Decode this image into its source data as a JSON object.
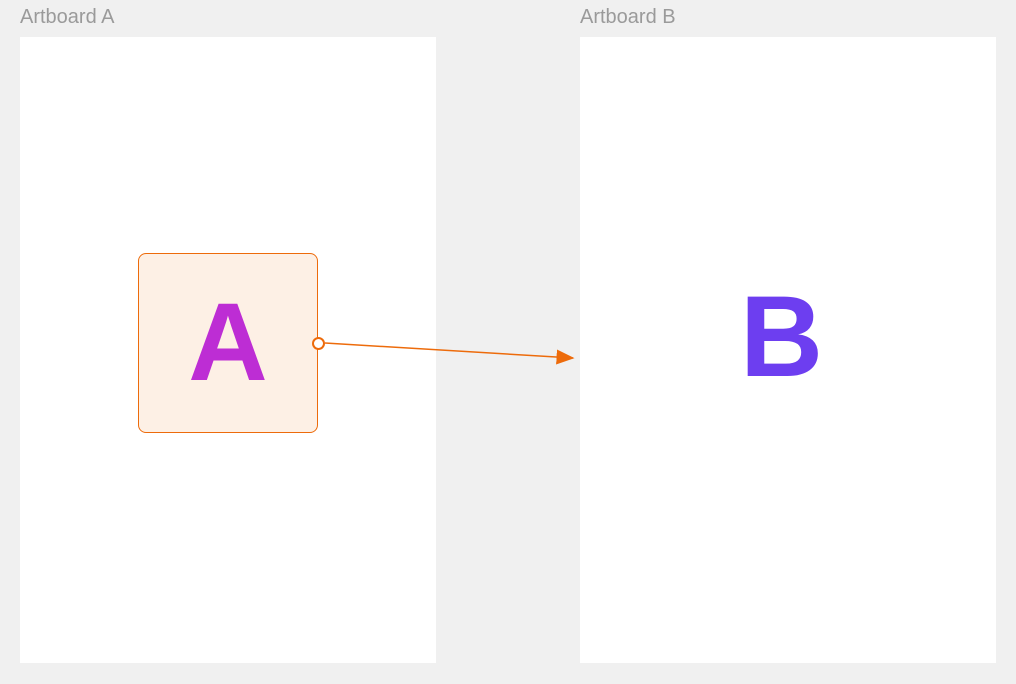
{
  "artboards": {
    "a": {
      "label": "Artboard A",
      "letter": "A"
    },
    "b": {
      "label": "Artboard B",
      "letter": "B"
    }
  },
  "colors": {
    "background": "#f0f0f0",
    "artboard": "#ffffff",
    "labelText": "#9a9a9a",
    "hotspotBorder": "#ed6b0b",
    "hotspotFill": "#fdf0e5",
    "letterA": "#bd2dd4",
    "letterB": "#6d3ef0",
    "connectionLine": "#ed6b0b"
  }
}
